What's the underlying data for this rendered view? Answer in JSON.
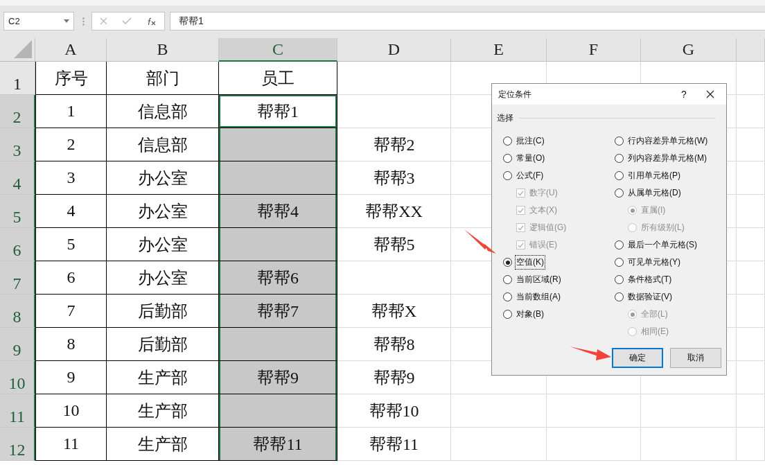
{
  "name_box": "C2",
  "formula_bar": {
    "value": "帮帮1"
  },
  "columns": [
    {
      "label": "A",
      "selected": false,
      "bordered": true
    },
    {
      "label": "B",
      "selected": false,
      "bordered": true
    },
    {
      "label": "C",
      "selected": true,
      "bordered": true
    },
    {
      "label": "D",
      "selected": false,
      "bordered": false
    },
    {
      "label": "E",
      "selected": false,
      "bordered": false
    },
    {
      "label": "F",
      "selected": false,
      "bordered": false
    },
    {
      "label": "G",
      "selected": false,
      "bordered": false
    }
  ],
  "rows": [
    {
      "number": "1",
      "selected": false,
      "cells": [
        {
          "text": "序号",
          "selected": false,
          "active": false
        },
        {
          "text": "部门",
          "selected": false,
          "active": false
        },
        {
          "text": "员工",
          "selected": false,
          "active": false
        }
      ]
    },
    {
      "number": "2",
      "selected": true,
      "cells": [
        {
          "text": "1",
          "selected": false,
          "active": false
        },
        {
          "text": "信息部",
          "selected": false,
          "active": false
        },
        {
          "text": "帮帮1",
          "selected": true,
          "active": true
        }
      ]
    },
    {
      "number": "3",
      "selected": true,
      "cells": [
        {
          "text": "2",
          "selected": false,
          "active": false
        },
        {
          "text": "信息部",
          "selected": false,
          "active": false
        },
        {
          "selected": true,
          "active": false
        },
        {
          "text": "帮帮2",
          "selected": false,
          "active": false
        }
      ]
    },
    {
      "number": "4",
      "selected": true,
      "cells": [
        {
          "text": "3",
          "selected": false,
          "active": false
        },
        {
          "text": "办公室",
          "selected": false,
          "active": false
        },
        {
          "selected": true,
          "active": false
        },
        {
          "text": "帮帮3",
          "selected": false,
          "active": false
        }
      ]
    },
    {
      "number": "5",
      "selected": true,
      "cells": [
        {
          "text": "4",
          "selected": false,
          "active": false
        },
        {
          "text": "办公室",
          "selected": false,
          "active": false
        },
        {
          "text": "帮帮4",
          "selected": true,
          "active": false
        },
        {
          "text": "帮帮XX",
          "selected": false,
          "active": false
        }
      ]
    },
    {
      "number": "6",
      "selected": true,
      "cells": [
        {
          "text": "5",
          "selected": false,
          "active": false
        },
        {
          "text": "办公室",
          "selected": false,
          "active": false
        },
        {
          "selected": true,
          "active": false
        },
        {
          "text": "帮帮5",
          "selected": false,
          "active": false
        }
      ]
    },
    {
      "number": "7",
      "selected": true,
      "cells": [
        {
          "text": "6",
          "selected": false,
          "active": false
        },
        {
          "text": "办公室",
          "selected": false,
          "active": false
        },
        {
          "text": "帮帮6",
          "selected": true,
          "active": false
        }
      ]
    },
    {
      "number": "8",
      "selected": true,
      "cells": [
        {
          "text": "7",
          "selected": false,
          "active": false
        },
        {
          "text": "后勤部",
          "selected": false,
          "active": false
        },
        {
          "text": "帮帮7",
          "selected": true,
          "active": false
        },
        {
          "text": "帮帮X",
          "selected": false,
          "active": false
        }
      ]
    },
    {
      "number": "9",
      "selected": true,
      "cells": [
        {
          "text": "8",
          "selected": false,
          "active": false
        },
        {
          "text": "后勤部",
          "selected": false,
          "active": false
        },
        {
          "selected": true,
          "active": false
        },
        {
          "text": "帮帮8",
          "selected": false,
          "active": false
        }
      ]
    },
    {
      "number": "10",
      "selected": true,
      "cells": [
        {
          "text": "9",
          "selected": false,
          "active": false
        },
        {
          "text": "生产部",
          "selected": false,
          "active": false
        },
        {
          "text": "帮帮9",
          "selected": true,
          "active": false
        },
        {
          "text": "帮帮9",
          "selected": false,
          "active": false
        }
      ]
    },
    {
      "number": "11",
      "selected": true,
      "cells": [
        {
          "text": "10",
          "selected": false,
          "active": false
        },
        {
          "text": "生产部",
          "selected": false,
          "active": false
        },
        {
          "selected": true,
          "active": false
        },
        {
          "text": "帮帮10",
          "selected": false,
          "active": false
        }
      ]
    },
    {
      "number": "12",
      "selected": true,
      "cells": [
        {
          "text": "11",
          "selected": false,
          "active": false
        },
        {
          "text": "生产部",
          "selected": false,
          "active": false
        },
        {
          "text": "帮帮11",
          "selected": true,
          "active": false
        },
        {
          "text": "帮帮11",
          "selected": false,
          "active": false
        }
      ]
    }
  ],
  "dialog": {
    "title": "定位条件",
    "help": "?",
    "group_label": "选择",
    "left_options": [
      {
        "kind": "radio",
        "label": "批注(C)",
        "selected": false,
        "disabled": false
      },
      {
        "kind": "radio",
        "label": "常量(O)",
        "selected": false,
        "disabled": false
      },
      {
        "kind": "radio",
        "label": "公式(F)",
        "selected": false,
        "disabled": false
      },
      {
        "kind": "checkbox",
        "label": "数字(U)",
        "checked": true,
        "disabled": true
      },
      {
        "kind": "checkbox",
        "label": "文本(X)",
        "checked": true,
        "disabled": true
      },
      {
        "kind": "checkbox",
        "label": "逻辑值(G)",
        "checked": true,
        "disabled": true
      },
      {
        "kind": "checkbox",
        "label": "错误(E)",
        "checked": true,
        "disabled": true
      },
      {
        "kind": "radio",
        "label": "空值(K)",
        "selected": true,
        "disabled": false
      },
      {
        "kind": "radio",
        "label": "当前区域(R)",
        "selected": false,
        "disabled": false
      },
      {
        "kind": "radio",
        "label": "当前数组(A)",
        "selected": false,
        "disabled": false
      },
      {
        "kind": "radio",
        "label": "对象(B)",
        "selected": false,
        "disabled": false
      }
    ],
    "right_options": [
      {
        "kind": "radio",
        "label": "行内容差异单元格(W)",
        "selected": false,
        "disabled": false
      },
      {
        "kind": "radio",
        "label": "列内容差异单元格(M)",
        "selected": false,
        "disabled": false
      },
      {
        "kind": "radio",
        "label": "引用单元格(P)",
        "selected": false,
        "disabled": false
      },
      {
        "kind": "radio",
        "label": "从属单元格(D)",
        "selected": false,
        "disabled": false
      },
      {
        "kind": "subradio",
        "label": "直属(I)",
        "selected": true,
        "disabled": true
      },
      {
        "kind": "subradio",
        "label": "所有级别(L)",
        "selected": false,
        "disabled": true
      },
      {
        "kind": "radio",
        "label": "最后一个单元格(S)",
        "selected": false,
        "disabled": false
      },
      {
        "kind": "radio",
        "label": "可见单元格(Y)",
        "selected": false,
        "disabled": false
      },
      {
        "kind": "radio",
        "label": "条件格式(T)",
        "selected": false,
        "disabled": false
      },
      {
        "kind": "radio",
        "label": "数据验证(V)",
        "selected": false,
        "disabled": false
      },
      {
        "kind": "subradio",
        "label": "全部(L)",
        "selected": true,
        "disabled": true
      },
      {
        "kind": "subradio",
        "label": "相同(E)",
        "selected": false,
        "disabled": true
      }
    ],
    "buttons": [
      {
        "label": "确定",
        "default": true
      },
      {
        "label": "取消",
        "default": false
      }
    ]
  }
}
